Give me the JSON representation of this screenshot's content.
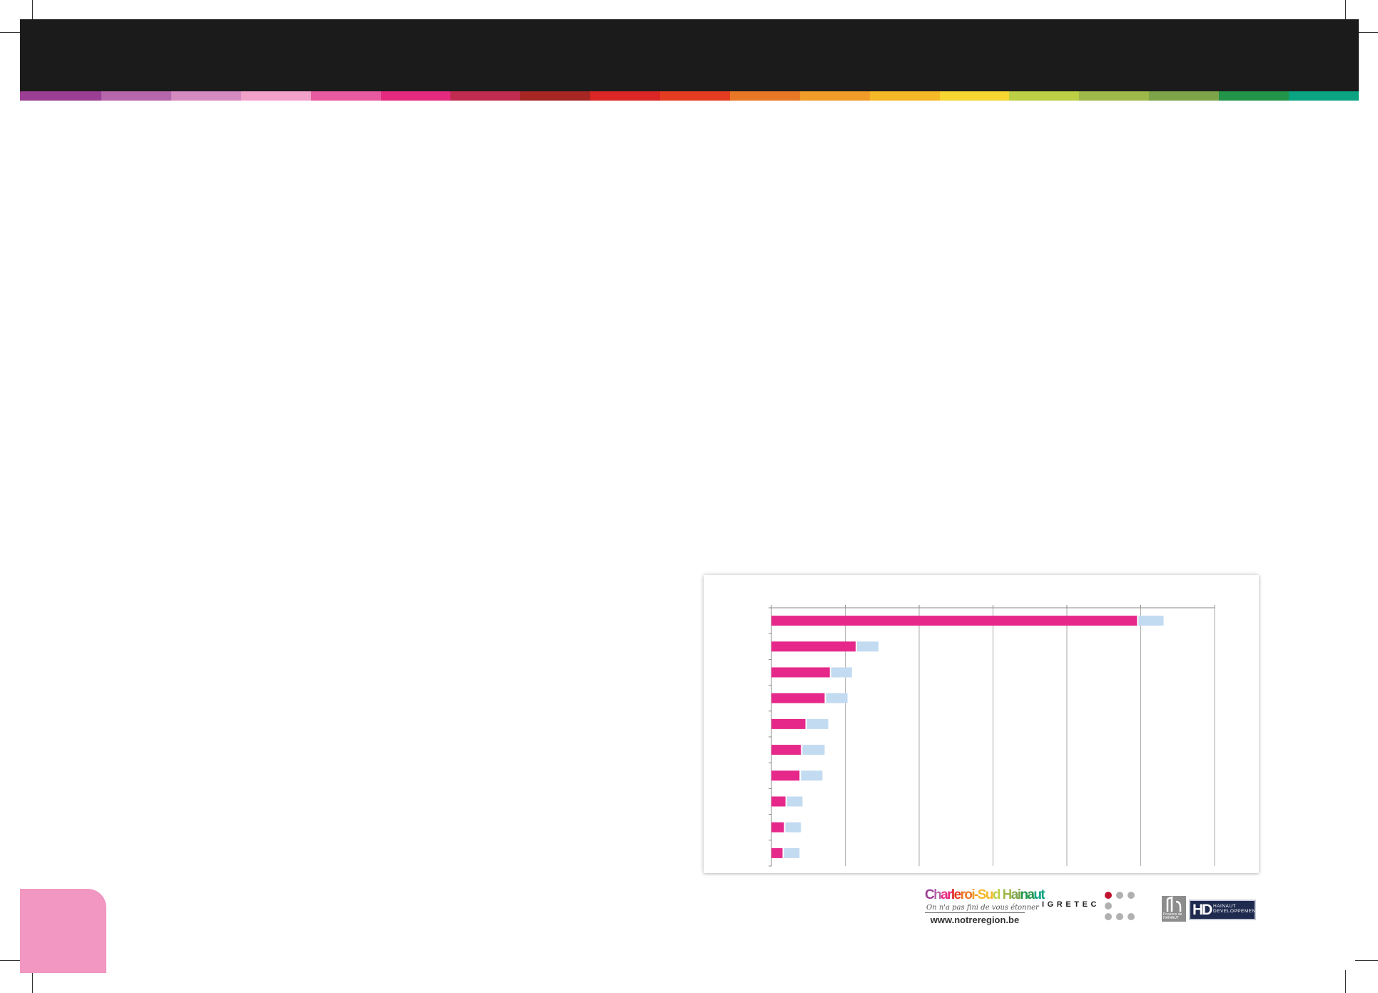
{
  "header": {
    "color_strip": [
      "#9b3f95",
      "#b667ab",
      "#d58ac0",
      "#f2a2ca",
      "#e9599f",
      "#e5297f",
      "#c12b4f",
      "#a52623",
      "#dc2525",
      "#e53c21",
      "#e97826",
      "#f19c28",
      "#f5b928",
      "#f7d631",
      "#bccf45",
      "#9fb84a",
      "#7ea44a",
      "#22954a",
      "#0aa483"
    ],
    "background": "#1b1b1b",
    "tab_color": "#f197c2"
  },
  "chart_data": {
    "type": "bar",
    "orientation": "horizontal",
    "categories": [
      "",
      "",
      "",
      "",
      "",
      "",
      "",
      "",
      "",
      ""
    ],
    "series": [
      {
        "color": "#e5288a",
        "values": [
          49.5,
          11.4,
          7.9,
          7.2,
          4.6,
          4.0,
          3.8,
          1.9,
          1.7,
          1.5
        ]
      },
      {
        "color": "#c3dbf1",
        "values": [
          3.6,
          3.1,
          3.0,
          3.1,
          3.1,
          3.2,
          3.1,
          2.3,
          2.3,
          2.3
        ]
      }
    ],
    "stacked": true,
    "xlim": [
      0,
      60
    ],
    "grid": true,
    "legend": "none",
    "title": "",
    "xlabel": "",
    "ylabel": ""
  },
  "logos": {
    "charleroi": {
      "brand_text": "Charleroi-Sud Hainaut",
      "tagline": "On n'a pas fini de vous étonner",
      "website": "www.notreregion.be"
    },
    "igretec": {
      "name": "IGRETEC",
      "dots_colors": [
        "#c0152f",
        "#b0b0b0"
      ]
    },
    "hainaut": {
      "province_label": "Province de HAINAUT",
      "mark": "HD",
      "name_line1": "HAINAUT",
      "name_line2": "DEVELOPPEMENT"
    }
  }
}
